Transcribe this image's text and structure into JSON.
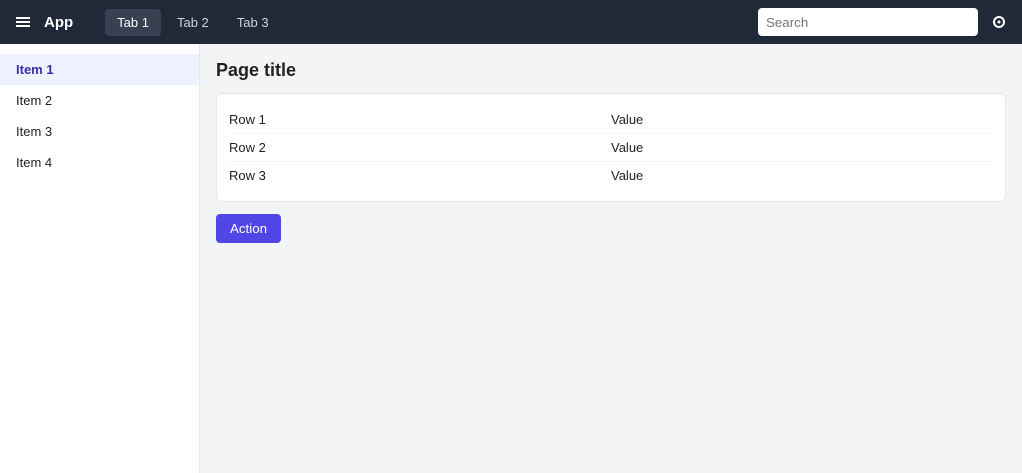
{
  "app": {
    "title": "App"
  },
  "tabs": [
    {
      "label": "Tab 1"
    },
    {
      "label": "Tab 2"
    },
    {
      "label": "Tab 3"
    }
  ],
  "search": {
    "placeholder": "Search"
  },
  "sidebar": {
    "items": [
      {
        "label": "Item 1"
      },
      {
        "label": "Item 2"
      },
      {
        "label": "Item 3"
      },
      {
        "label": "Item 4"
      }
    ]
  },
  "main": {
    "title": "Page title",
    "rows": [
      {
        "a": "Row 1",
        "b": "Value"
      },
      {
        "a": "Row 2",
        "b": "Value"
      },
      {
        "a": "Row 3",
        "b": "Value"
      }
    ],
    "action_label": "Action"
  }
}
